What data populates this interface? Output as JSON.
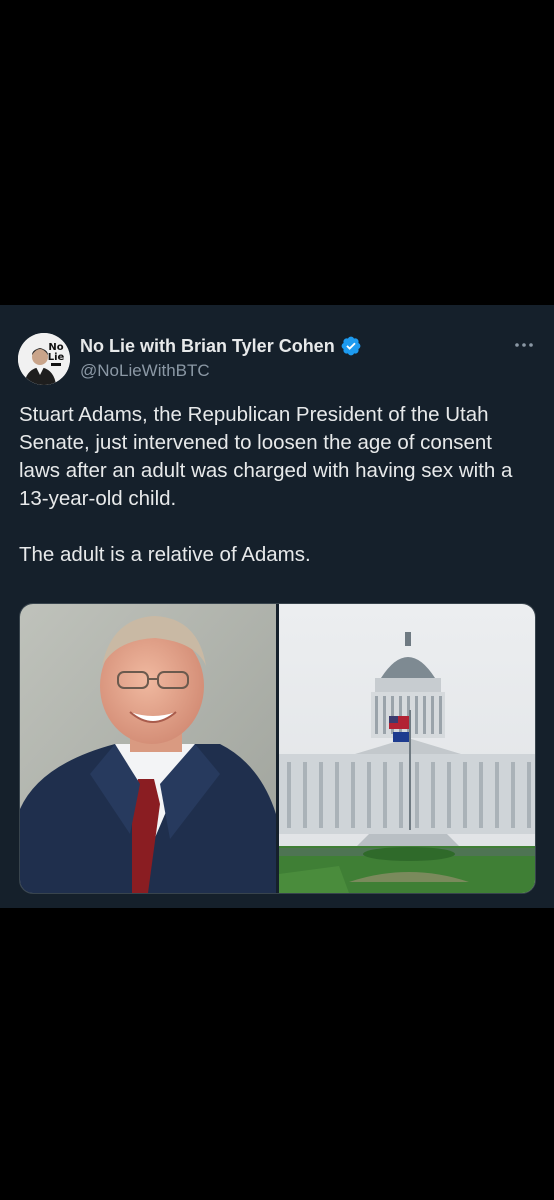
{
  "tweet": {
    "author_name": "No Lie with Brian Tyler Cohen",
    "author_handle": "@NoLieWithBTC",
    "avatar_logo_text": "No Lie",
    "verified": true,
    "paragraphs": [
      "Stuart Adams, the Republican President of the Utah Senate, just intervened to loosen the age of consent laws after an adult was charged with having sex with a 13-year-old child.",
      "The adult is a relative of Adams."
    ],
    "media": [
      {
        "kind": "photo",
        "subject": "portrait-photo"
      },
      {
        "kind": "photo",
        "subject": "capitol-building-photo"
      }
    ]
  },
  "colors": {
    "background": "#000000",
    "card": "#15202b",
    "text": "#e7e9ea",
    "secondary_text": "#8b98a5",
    "verified": "#1d9bf0"
  },
  "icons": {
    "verified": "verified-badge-icon",
    "more": "more-dots-icon"
  }
}
